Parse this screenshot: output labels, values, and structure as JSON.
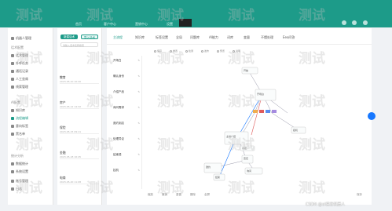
{
  "topbar": {
    "tabs": [
      "首页",
      "客户中心",
      "营销中心",
      "设置"
    ],
    "icons": [
      "settings-icon",
      "user-icon",
      "more-icon"
    ]
  },
  "sidebar": {
    "items": [
      {
        "label": "机器人管理",
        "active": false
      },
      {
        "label": "话术管理",
        "active": false
      },
      {
        "label": "外呼任务",
        "active": false
      },
      {
        "label": "通话记录",
        "active": false
      },
      {
        "label": "人工坐席",
        "active": false
      },
      {
        "label": "线索管理",
        "active": false
      },
      {
        "label": "知识库",
        "active": false
      },
      {
        "label": "流程编辑",
        "active": true
      },
      {
        "label": "意向标签",
        "active": false
      },
      {
        "label": "黑名单",
        "active": false
      },
      {
        "label": "数据统计",
        "active": false
      },
      {
        "label": "系统设置",
        "active": false
      },
      {
        "label": "账号管理",
        "active": false
      },
      {
        "label": "日志",
        "active": false
      }
    ],
    "groups": [
      "话术配置",
      "AI配置",
      "统计分析"
    ]
  },
  "listpanel": {
    "btn_new": "新建话术",
    "btn_import": "导入话术",
    "search_placeholder": "请输入话术名称搜索",
    "cards": [
      {
        "title": "教育",
        "meta": "2023-05-10 10:20"
      },
      {
        "title": "房产",
        "meta": "2023-05-12 14:32"
      },
      {
        "title": "保险",
        "meta": "2023-05-15 09:11"
      },
      {
        "title": "金融",
        "meta": "2023-05-18 16:45"
      },
      {
        "title": "电商",
        "meta": "2023-05-20 11:08"
      }
    ]
  },
  "editor": {
    "toolbar": [
      "主流程",
      "知识库",
      "标签设置",
      "全局",
      "问题库",
      "AI能力",
      "词库",
      "变量",
      "不懂处理",
      "Eeo问答"
    ],
    "status": [
      "保存",
      "重置",
      "检测",
      "发布",
      "预览",
      "说明"
    ],
    "tree": [
      "开场白",
      "确认身份",
      "介绍产品",
      "询问需求",
      "邀约到店",
      "处理异议",
      "结束语",
      "挂机"
    ],
    "node_labels": [
      "开始",
      "开场白",
      "主动介绍",
      "肯定",
      "否定",
      "拒绝",
      "挂机",
      "邀约",
      "询问",
      "结束"
    ],
    "bottom_tools": [
      "缩放",
      "撤销",
      "重做",
      "删除",
      "全屏",
      "保存"
    ]
  },
  "watermark": {
    "text": "测试"
  },
  "footer": {
    "credit": "CSDN @ai语音机器人"
  }
}
